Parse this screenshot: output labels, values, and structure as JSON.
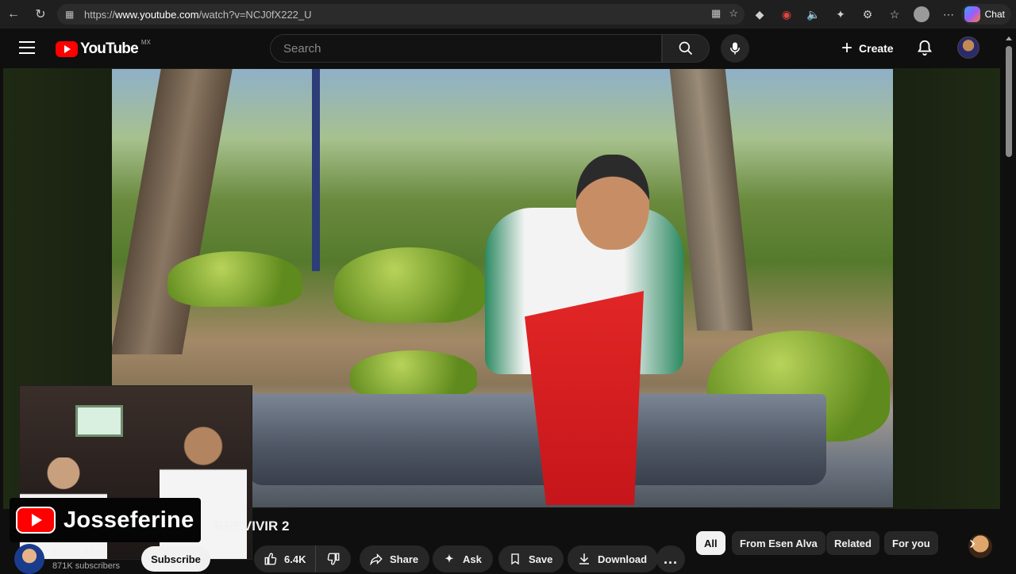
{
  "browser": {
    "url_prefix": "https://",
    "url_host": "www.youtube.com",
    "url_path": "/watch?v=NCJ0fX222_U",
    "chat_label": "Chat"
  },
  "header": {
    "logo_text": "YouTube",
    "country_code": "MX",
    "search_placeholder": "Search",
    "create_label": "Create"
  },
  "overlay": {
    "brand_name": "Josseferine"
  },
  "video": {
    "title_visible": "BREVIVIR 2"
  },
  "channel": {
    "name": "Esen Alva",
    "subscribers": "871K subscribers",
    "subscribe_label": "Subscribe"
  },
  "actions": {
    "like_count": "6.4K",
    "share_label": "Share",
    "ask_label": "Ask",
    "save_label": "Save",
    "download_label": "Download",
    "more_label": "..."
  },
  "chips": [
    {
      "label": "All",
      "active": true
    },
    {
      "label": "From Esen Alva",
      "active": false
    },
    {
      "label": "Related",
      "active": false
    },
    {
      "label": "For you",
      "active": false
    }
  ],
  "colors": {
    "brand_red": "#ff0000",
    "background": "#0f0f0f",
    "pill": "#272727"
  }
}
